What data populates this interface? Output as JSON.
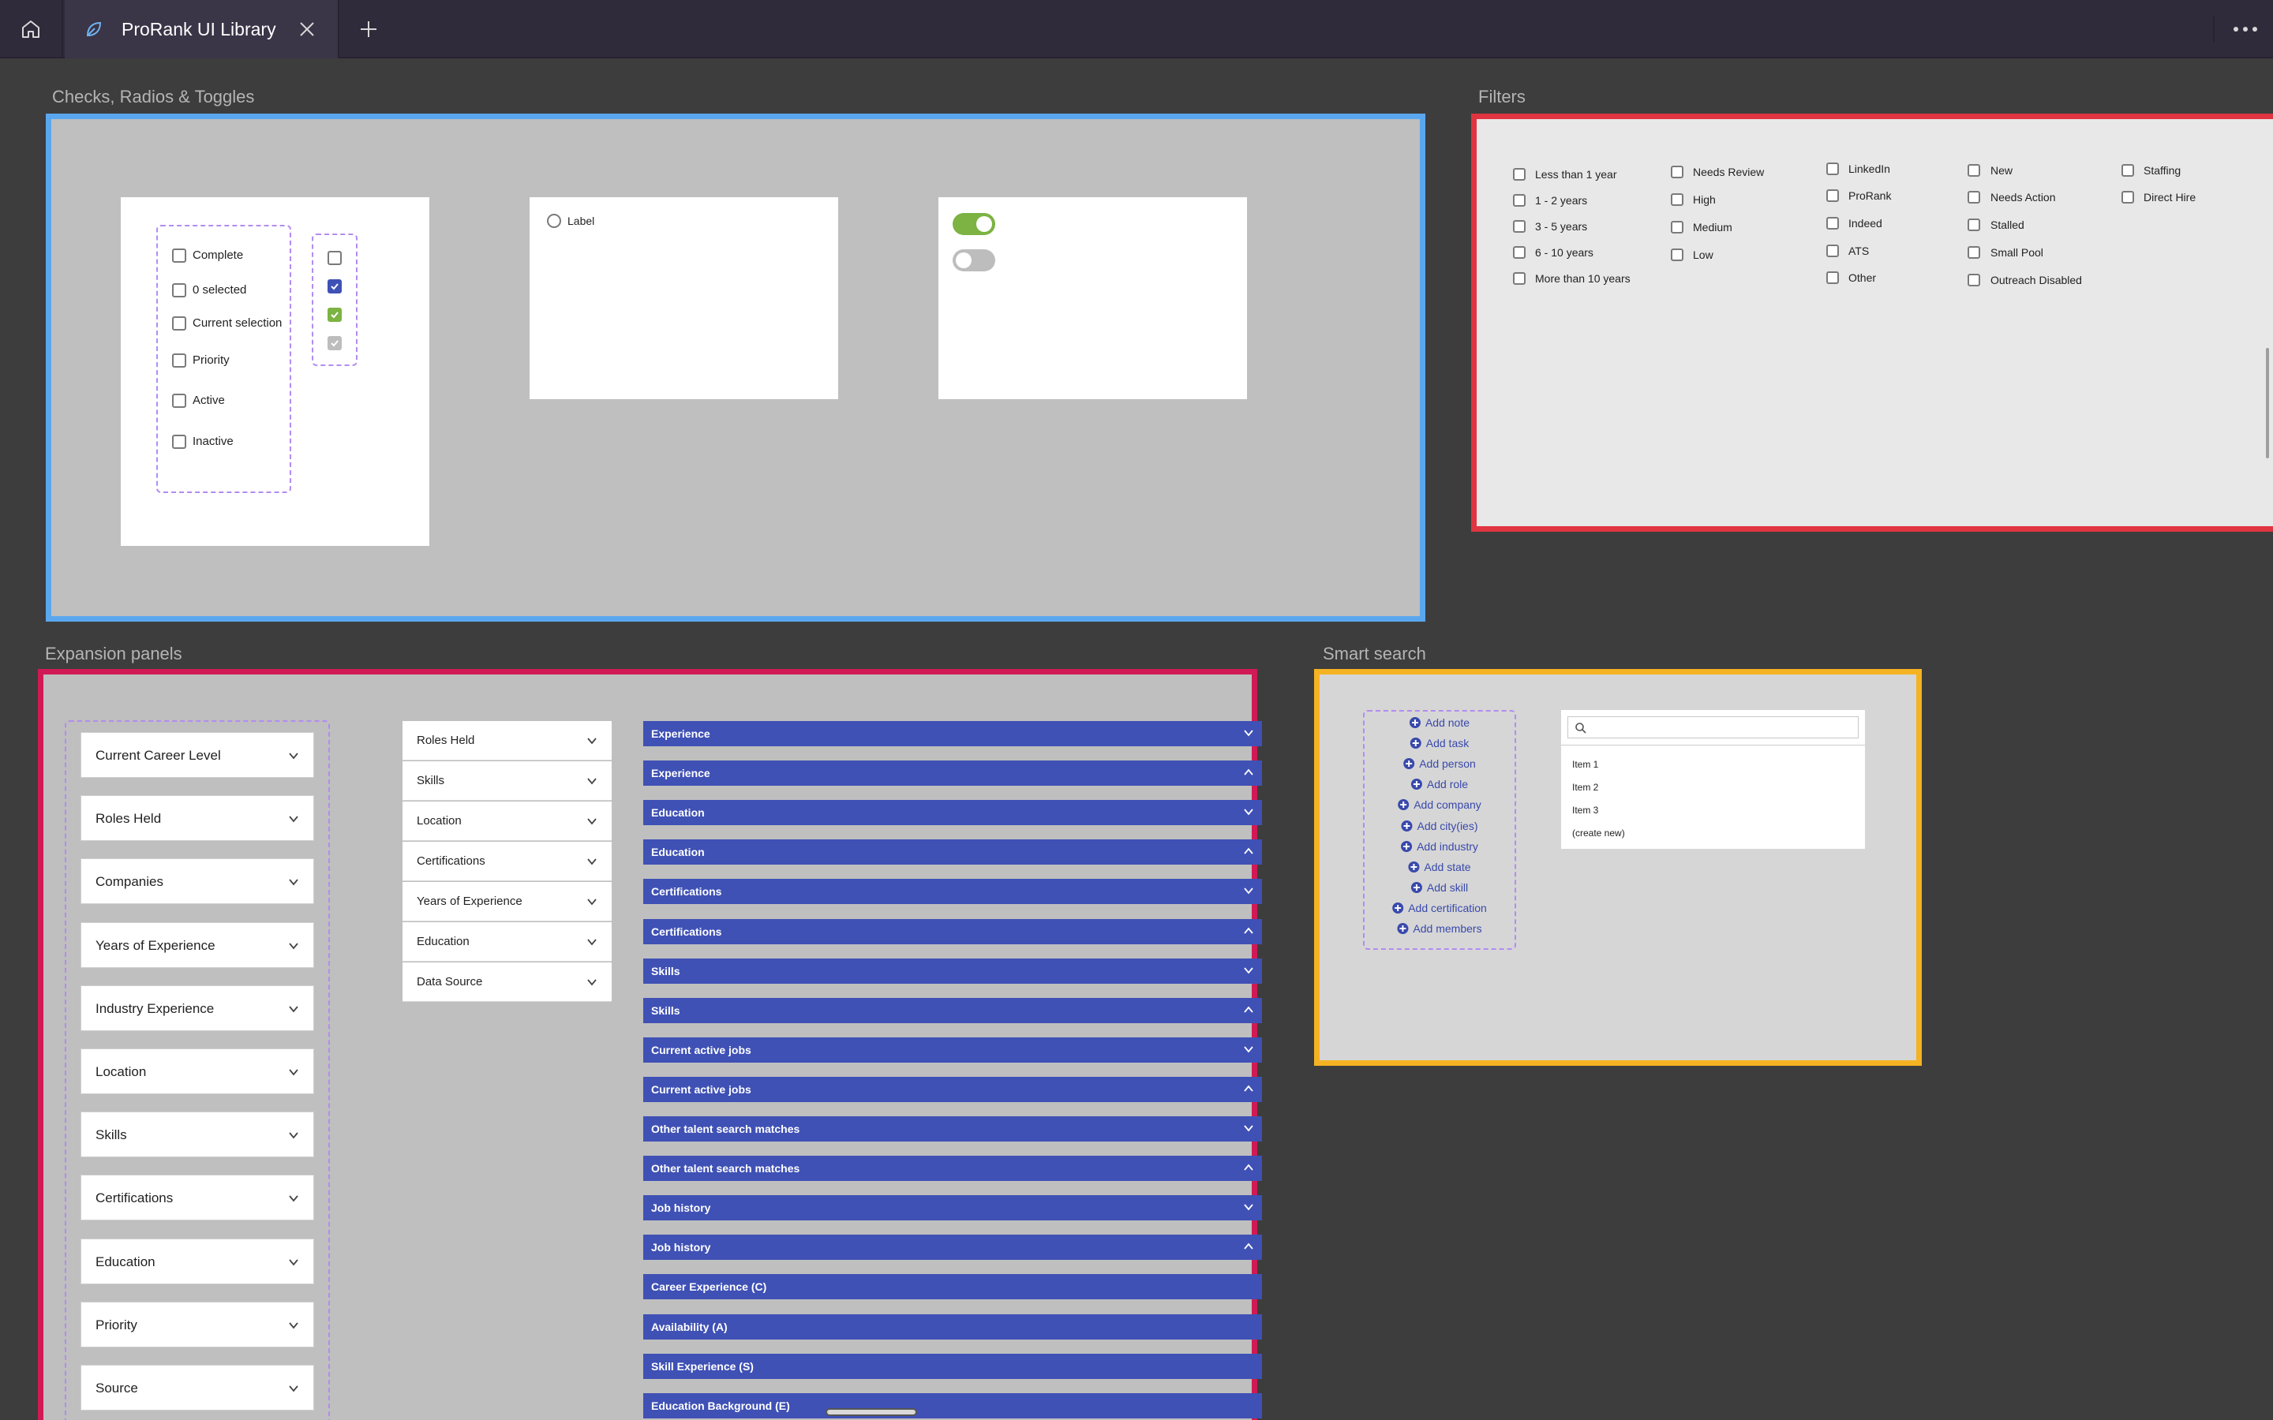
{
  "topbar": {
    "tab_title": "ProRank UI Library",
    "icons": [
      "home-icon",
      "leaf-icon",
      "close-icon",
      "plus-icon",
      "more-icon"
    ]
  },
  "colors": {
    "checks_frame": "#5aa7ef",
    "filters_frame": "#e03440",
    "expansion_frame": "#d11a55",
    "smart_search_frame": "#f5b323",
    "accent": "#3f51b5",
    "toggle_on": "#7cb342"
  },
  "checks": {
    "title": "Checks, Radios & Toggles",
    "checkbox_labels": [
      "Complete",
      "0 selected",
      "Current selection",
      "Priority",
      "Active",
      "Inactive"
    ],
    "checkbox_states": [
      "unchecked",
      "checked",
      "checked-green",
      "checked-disabled"
    ],
    "radio_label": "Label",
    "toggles": [
      "on",
      "off"
    ]
  },
  "filters": {
    "title": "Filters",
    "columns": [
      [
        "Less than 1 year",
        "1 - 2 years",
        "3 - 5 years",
        "6 - 10 years",
        "More than 10 years"
      ],
      [
        "Needs Review",
        "High",
        "Medium",
        "Low"
      ],
      [
        "LinkedIn",
        "ProRank",
        "Indeed",
        "ATS",
        "Other"
      ],
      [
        "New",
        "Needs Action",
        "Stalled",
        "Small Pool",
        "Outreach Disabled"
      ],
      [
        "Staffing",
        "Direct Hire"
      ]
    ]
  },
  "expansion": {
    "title": "Expansion panels",
    "cards": [
      "Current Career Level",
      "Roles Held",
      "Companies",
      "Years of Experience",
      "Industry Experience",
      "Location",
      "Skills",
      "Certifications",
      "Education",
      "Priority",
      "Source"
    ],
    "flat": [
      "Roles Held",
      "Skills",
      "Location",
      "Certifications",
      "Years of Experience",
      "Education",
      "Data Source"
    ],
    "bars": [
      {
        "label": "Experience",
        "state": "collapsed"
      },
      {
        "label": "Experience",
        "state": "expanded"
      },
      {
        "label": "Education",
        "state": "collapsed"
      },
      {
        "label": "Education",
        "state": "expanded"
      },
      {
        "label": "Certifications",
        "state": "collapsed"
      },
      {
        "label": "Certifications",
        "state": "expanded"
      },
      {
        "label": "Skills",
        "state": "collapsed"
      },
      {
        "label": "Skills",
        "state": "expanded"
      },
      {
        "label": "Current active jobs",
        "state": "collapsed"
      },
      {
        "label": "Current active jobs",
        "state": "expanded"
      },
      {
        "label": "Other talent search matches",
        "state": "collapsed"
      },
      {
        "label": "Other talent search matches",
        "state": "expanded"
      },
      {
        "label": "Job history",
        "state": "collapsed"
      },
      {
        "label": "Job history",
        "state": "expanded"
      },
      {
        "label": "Career Experience (C)",
        "state": "none"
      },
      {
        "label": "Availability (A)",
        "state": "none"
      },
      {
        "label": "Skill Experience (S)",
        "state": "none"
      },
      {
        "label": "Education Background (E)",
        "state": "none"
      }
    ]
  },
  "smart_search": {
    "title": "Smart search",
    "actions": [
      "Add note",
      "Add task",
      "Add person",
      "Add role",
      "Add company",
      "Add city(ies)",
      "Add industry",
      "Add state",
      "Add skill",
      "Add certification",
      "Add members"
    ],
    "search_placeholder": "",
    "items": [
      "Item 1",
      "Item 2",
      "Item 3",
      "(create new)"
    ]
  }
}
